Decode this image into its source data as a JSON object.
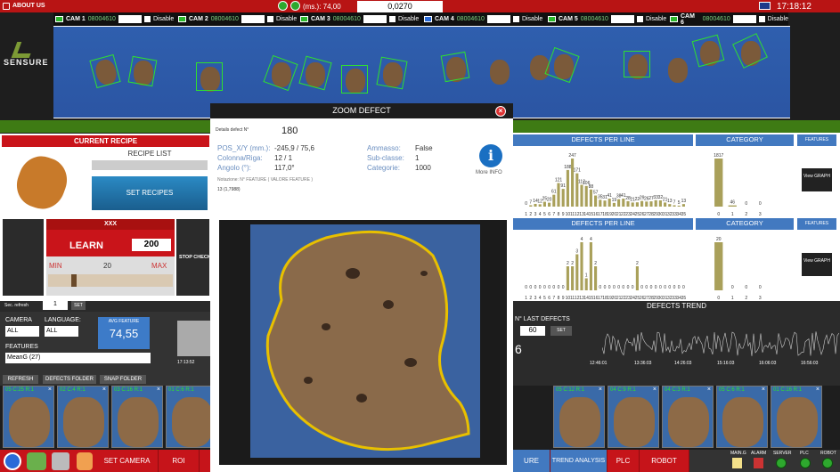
{
  "topbar": {
    "about": "ABOUT US",
    "ms_label": "(ms.): 74,00",
    "value": "0,0270",
    "clock": "17:18:12"
  },
  "cameras": [
    {
      "name": "CAM 1",
      "code": "08004610",
      "disable": "Disable",
      "color": "#2db82d"
    },
    {
      "name": "CAM 2",
      "code": "08004610",
      "disable": "Disable",
      "color": "#2db82d"
    },
    {
      "name": "CAM 3",
      "code": "08004610",
      "disable": "Disable",
      "color": "#2db82d"
    },
    {
      "name": "CAM 4",
      "code": "08004610",
      "disable": "Disable",
      "color": "#2a6ad8"
    },
    {
      "name": "CAM 5",
      "code": "08004610",
      "disable": "Disable",
      "color": "#2db82d"
    },
    {
      "name": "CAM 6",
      "code": "08004610",
      "disable": "Disable",
      "color": "#2db82d"
    }
  ],
  "logo": {
    "text": "SENSURE"
  },
  "left": {
    "current_recipe": "CURRENT RECIPE",
    "recipe_list": "RECIPE LIST",
    "set_recipes": "SET RECIPES",
    "xxx": "XXX",
    "learn": "LEARN",
    "learn_value": "200",
    "min": "MIN",
    "max": "MAX",
    "slider_value": "20",
    "stop_check": "STOP CHECK",
    "sec_refresh": "Sec. refresh",
    "refresh_value": "1",
    "set": "SET",
    "camera_label": "CAMERA",
    "camera_value": "ALL",
    "language_label": "LANGUAGE:",
    "language_value": "ALL",
    "avg_feature": "AVG FEATURE",
    "avg_value": "74,55",
    "features_label": "FEATURES",
    "features_value": "MeanG (27)",
    "time": "17:13:52",
    "refresh_btn": "REFRESH",
    "defects_folder": "DEFECTS FOLDER",
    "snap_folder": "SNAP FOLDER"
  },
  "modal": {
    "title": "ZOOM DEFECT",
    "details_label": "Details defect N°",
    "details_value": "180",
    "pos_label": "POS_X/Y (mm.):",
    "pos_value": "-245,9 / 75,6",
    "colriga_label": "Colonna/Riga:",
    "colriga_value": "12 / 1",
    "angolo_label": "Angolo (°):",
    "angolo_value": "117,0°",
    "ammasso_label": "Ammasso:",
    "ammasso_value": "False",
    "subclasse_label": "Sub-classe:",
    "subclasse_value": "1",
    "categorie_label": "Categorie:",
    "categorie_value": "1000",
    "notazione": "Notazione: N° FEATURE ( VALORE FEATURE )",
    "feature_value": "13 (1,7988)",
    "more_info": "More INFO"
  },
  "right": {
    "defects_per_line": "DEFECTS PER LINE",
    "category": "CATEGORY",
    "features": "FEATURES",
    "view_graph": "View GRAPH",
    "defects_trend": "DEFECTS TREND",
    "last_defects_label": "N° LAST DEFECTS",
    "last_defects_value": "60",
    "set": "SET",
    "big_digit": "6",
    "trend_times": [
      "12:46:01",
      "13:36:03",
      "14:26:03",
      "15:16:03",
      "16:06:03",
      "16:56:03"
    ]
  },
  "chart_data": [
    {
      "type": "bar",
      "title": "DEFECTS PER LINE",
      "categories": [
        "1",
        "2",
        "3",
        "4",
        "5",
        "6",
        "7",
        "8",
        "9",
        "10",
        "11",
        "12",
        "13",
        "14",
        "15",
        "16",
        "17",
        "18",
        "19",
        "20",
        "21",
        "22",
        "23",
        "24",
        "25",
        "26",
        "27",
        "28",
        "29",
        "30",
        "31",
        "32",
        "33",
        "34",
        "35"
      ],
      "values": [
        0,
        7,
        14,
        12,
        25,
        20,
        61,
        121,
        91,
        188,
        247,
        171,
        112,
        106,
        88,
        57,
        35,
        31,
        41,
        19,
        38,
        41,
        28,
        21,
        22,
        29,
        26,
        27,
        33,
        32,
        21,
        13,
        7,
        5,
        13
      ]
    },
    {
      "type": "bar",
      "title": "CATEGORY",
      "categories": [
        "0",
        "1",
        "2",
        "3"
      ],
      "values": [
        1817,
        46,
        0,
        0
      ]
    },
    {
      "type": "bar",
      "title": "DEFECTS PER LINE",
      "categories": [
        "1",
        "2",
        "3",
        "4",
        "5",
        "6",
        "7",
        "8",
        "9",
        "10",
        "11",
        "12",
        "13",
        "14",
        "15",
        "16",
        "17",
        "18",
        "19",
        "20",
        "21",
        "22",
        "23",
        "24",
        "25",
        "26",
        "27",
        "28",
        "29",
        "30",
        "31",
        "32",
        "33",
        "34",
        "35"
      ],
      "values": [
        0,
        0,
        0,
        0,
        0,
        0,
        0,
        0,
        0,
        2,
        2,
        3,
        4,
        1,
        4,
        2,
        0,
        0,
        0,
        0,
        0,
        0,
        0,
        0,
        2,
        0,
        0,
        0,
        0,
        0,
        0,
        0,
        0,
        0,
        0
      ]
    },
    {
      "type": "bar",
      "title": "CATEGORY",
      "categories": [
        "0",
        "1",
        "2",
        "3"
      ],
      "values": [
        20,
        0,
        0,
        0
      ]
    }
  ],
  "thumbs": [
    {
      "cam": "05 C:25 R:1"
    },
    {
      "cam": "02 C:4 R:1"
    },
    {
      "cam": "03 C:16 R:1"
    },
    {
      "cam": "01 C:6 R:1"
    },
    {
      "cam": "05 C:12 R:1"
    },
    {
      "cam": "04 C:9 R:1"
    },
    {
      "cam": "04 C:3 R:1"
    },
    {
      "cam": "05 C:6 R:1"
    },
    {
      "cam": "01 C:16 R:1"
    }
  ],
  "bottom": {
    "set_camera": "SET CAMERA",
    "roi": "ROI",
    "ure": "URE",
    "trend_analysis": "TREND ANALYSIS",
    "plc": "PLC",
    "robot": "ROBOT",
    "status": [
      "MAIN.G",
      "ALARM",
      "SERVER",
      "PLC",
      "ROBOT"
    ]
  }
}
